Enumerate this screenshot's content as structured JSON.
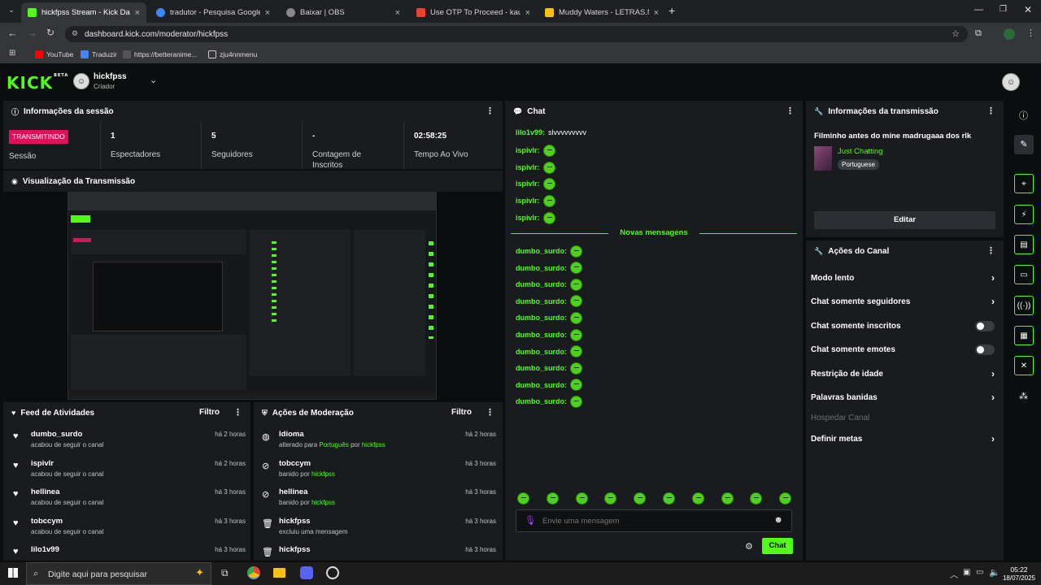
{
  "browser": {
    "tabs": [
      {
        "title": "hickfpss Stream - Kick Dashbo",
        "color": "#53fc18",
        "active": true
      },
      {
        "title": "tradutor - Pesquisa Google",
        "color": "#4285f4"
      },
      {
        "title": "Baixar | OBS",
        "color": "#888888"
      },
      {
        "title": "Use OTP To Proceed - kauah62",
        "color": "#ea4335"
      },
      {
        "title": "Muddy Waters - LETRAS.MUS.B",
        "color": "#f4c20d"
      }
    ],
    "url": "dashboard.kick.com/moderator/hickfpss",
    "bookmarks": [
      "YouTube",
      "Traduzir",
      "https://betteranime...",
      "zju4nnmenu"
    ]
  },
  "header": {
    "logo": "KICK",
    "logo_badge": "BETA",
    "username": "hickfpss",
    "role": "Criador"
  },
  "session": {
    "title": "Informações da sessão",
    "status_badge": "TRANSMITINDO",
    "status_label": "Sessão",
    "stats": [
      {
        "value": "1",
        "label": "Espectadores"
      },
      {
        "value": "5",
        "label": "Seguidores"
      },
      {
        "value": "-",
        "label": "Contagem de Inscritos"
      },
      {
        "value": "02:58:25",
        "label": "Tempo Ao Vivo"
      }
    ]
  },
  "preview": {
    "title": "Visualização da Transmissão"
  },
  "activity_feed": {
    "title": "Feed de Atividades",
    "filter": "Filtro",
    "items": [
      {
        "name": "dumbo_surdo",
        "desc": "acabou de seguir o canal",
        "time": "há 2 horas"
      },
      {
        "name": "ispivlr",
        "desc": "acabou de seguir o canal",
        "time": "há 2 horas"
      },
      {
        "name": "hellinea",
        "desc": "acabou de seguir o canal",
        "time": "há 3 horas"
      },
      {
        "name": "tobccym",
        "desc": "acabou de seguir o canal",
        "time": "há 3 horas"
      },
      {
        "name": "lilo1v99",
        "desc": "",
        "time": "há 3 horas"
      }
    ]
  },
  "moderation": {
    "title": "Ações de Moderação",
    "filter": "Filtro",
    "items": [
      {
        "name": "Idioma",
        "desc_pre": "alterado para ",
        "desc_hl": "Português",
        "desc_mid": " por ",
        "desc_user": "hickfpss",
        "time": "há 2 horas",
        "icon": "globe-icon"
      },
      {
        "name": "tobccym",
        "desc_pre": "banido por ",
        "desc_hl": "",
        "desc_mid": "",
        "desc_user": "hickfpss",
        "time": "há 3 horas",
        "icon": "ban-icon"
      },
      {
        "name": "hellinea",
        "desc_pre": "banido por ",
        "desc_hl": "",
        "desc_mid": "",
        "desc_user": "hickfpss",
        "time": "há 3 horas",
        "icon": "ban-icon"
      },
      {
        "name": "hickfpss",
        "desc_pre": "excluiu uma mensagem",
        "desc_hl": "",
        "desc_mid": "",
        "desc_user": "",
        "time": "há 3 horas",
        "icon": "trash-icon"
      },
      {
        "name": "hickfpss",
        "desc_pre": "",
        "desc_hl": "",
        "desc_mid": "",
        "desc_user": "",
        "time": "há 3 horas",
        "icon": "trash-icon"
      }
    ]
  },
  "chat": {
    "title": "Chat",
    "first_message": {
      "user": "lilo1v99:",
      "text": "slvvvvvvvvv"
    },
    "early_users": [
      "ispivlr:",
      "ispivlr:",
      "ispivlr:",
      "ispivlr:",
      "ispivlr:"
    ],
    "divider": "Novas mensagens",
    "new_users": [
      "dumbo_surdo:",
      "dumbo_surdo:",
      "dumbo_surdo:",
      "dumbo_surdo:",
      "dumbo_surdo:",
      "dumbo_surdo:",
      "dumbo_surdo:",
      "dumbo_surdo:",
      "dumbo_surdo:",
      "dumbo_surdo:"
    ],
    "input_placeholder": "Envie uma mensagem",
    "send_label": "Chat"
  },
  "stream_info": {
    "title": "Informações da transmissão",
    "stream_title": "Filminho antes do mine madrugaaa dos rlk",
    "category": "Just Chatting",
    "language": "Portuguese",
    "edit_label": "Editar"
  },
  "channel_actions": {
    "title": "Ações do Canal",
    "items": [
      {
        "label": "Modo lento",
        "type": "chevron"
      },
      {
        "label": "Chat somente seguidores",
        "type": "chevron"
      },
      {
        "label": "Chat somente inscritos",
        "type": "toggle"
      },
      {
        "label": "Chat somente emotes",
        "type": "toggle"
      },
      {
        "label": "Restrição de idade",
        "type": "chevron"
      },
      {
        "label": "Palavras banidas",
        "type": "chevron"
      },
      {
        "label": "Hospedar Canal",
        "type": "disabled"
      },
      {
        "label": "Definir metas",
        "type": "chevron"
      }
    ]
  },
  "taskbar": {
    "search_placeholder": "Digite aqui para pesquisar",
    "time": "05:22",
    "date": "18/07/2025"
  }
}
